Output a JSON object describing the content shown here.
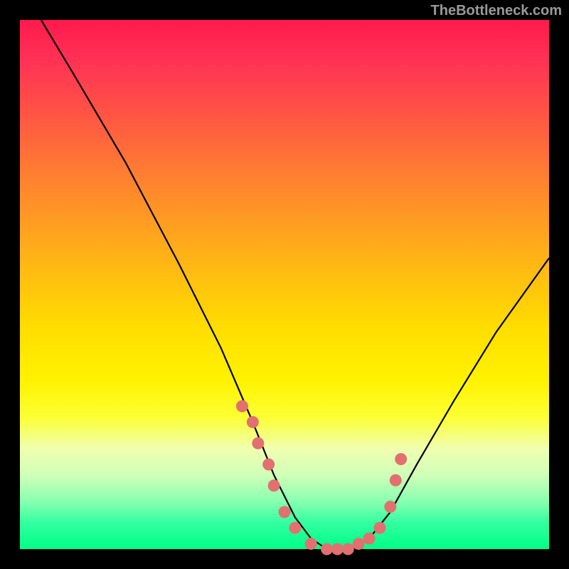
{
  "watermark": "TheBottleneck.com",
  "chart_data": {
    "type": "line",
    "title": "",
    "xlabel": "",
    "ylabel": "",
    "xlim": [
      0,
      100
    ],
    "ylim": [
      0,
      100
    ],
    "series": [
      {
        "name": "curve",
        "x": [
          4,
          10,
          20,
          30,
          38,
          44,
          48,
          52,
          55,
          58,
          60,
          63,
          66,
          70,
          75,
          82,
          90,
          100
        ],
        "y": [
          100,
          90,
          73,
          54,
          38,
          24,
          14,
          6,
          2,
          0,
          0,
          0,
          2,
          7,
          16,
          28,
          41,
          55
        ]
      },
      {
        "name": "dots",
        "type": "scatter",
        "x": [
          42,
          44,
          45,
          47,
          48,
          50,
          52,
          55,
          58,
          60,
          62,
          64,
          66,
          68,
          70,
          71,
          72
        ],
        "y": [
          27,
          24,
          20,
          16,
          12,
          7,
          4,
          1,
          0,
          0,
          0,
          1,
          2,
          4,
          8,
          13,
          17
        ]
      }
    ],
    "gradient_stops": [
      {
        "pos": 0,
        "color": "#ff1a4d"
      },
      {
        "pos": 68,
        "color": "#ffdd00"
      },
      {
        "pos": 100,
        "color": "#00ff88"
      }
    ]
  }
}
